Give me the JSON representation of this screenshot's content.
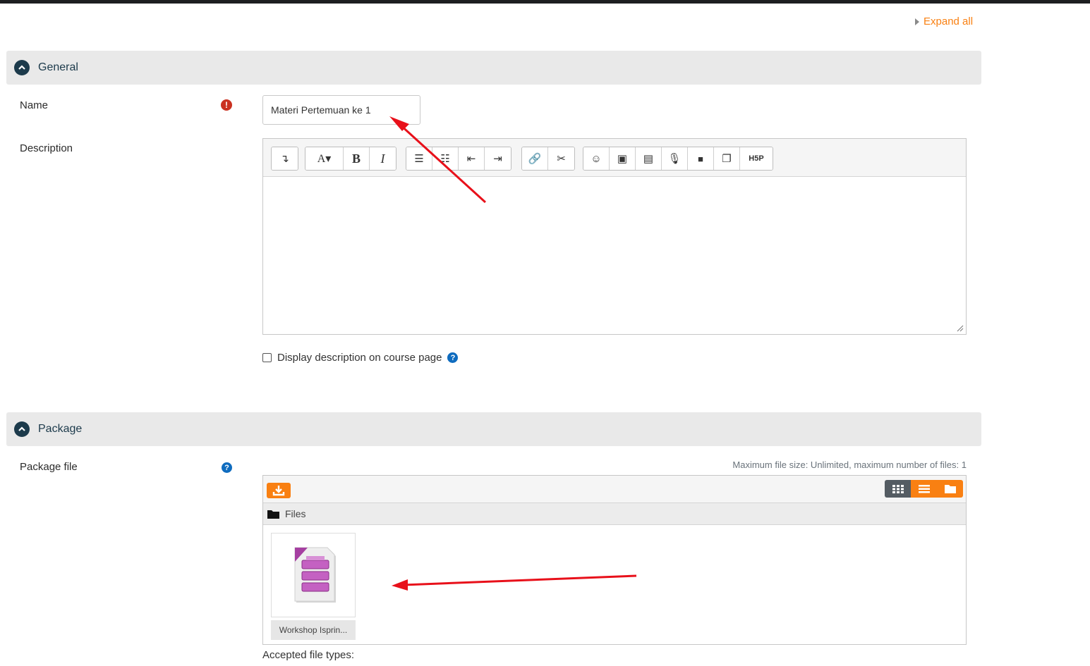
{
  "expand_all": "Expand all",
  "general": {
    "title": "General",
    "name_label": "Name",
    "name_value": "Materi Pertemuan ke 1",
    "required_icon": "exclamation-circle-icon",
    "description_label": "Description",
    "display_checkbox_label": "Display description on course page",
    "display_checkbox_checked": false
  },
  "editor_toolbar": {
    "groups": [
      [
        {
          "name": "collapse-icon",
          "glyph": "↴"
        }
      ],
      [
        {
          "name": "font-style-icon",
          "glyph": "A▾"
        },
        {
          "name": "bold-icon",
          "glyph": "B"
        },
        {
          "name": "italic-icon",
          "glyph": "I"
        }
      ],
      [
        {
          "name": "unordered-list-icon",
          "glyph": "☰"
        },
        {
          "name": "ordered-list-icon",
          "glyph": "☷"
        },
        {
          "name": "outdent-icon",
          "glyph": "⇤"
        },
        {
          "name": "indent-icon",
          "glyph": "⇥"
        }
      ],
      [
        {
          "name": "link-icon",
          "glyph": "🔗"
        },
        {
          "name": "unlink-icon",
          "glyph": "✂"
        }
      ],
      [
        {
          "name": "emoji-icon",
          "glyph": "☺"
        },
        {
          "name": "image-icon",
          "glyph": "▣"
        },
        {
          "name": "media-icon",
          "glyph": "▤"
        },
        {
          "name": "record-audio-icon",
          "glyph": "🎙"
        },
        {
          "name": "record-video-icon",
          "glyph": "■"
        },
        {
          "name": "manage-files-icon",
          "glyph": "❐"
        },
        {
          "name": "h5p-icon",
          "glyph": "H5P"
        }
      ]
    ]
  },
  "package": {
    "title": "Package",
    "package_file_label": "Package file",
    "max_size_text": "Maximum file size: Unlimited, maximum number of files: 1",
    "files_path": "Files",
    "file_name": "Workshop Isprin...",
    "accepted_types": "Accepted file types:"
  },
  "colors": {
    "accent": "#f98012",
    "section_header_bg": "#e9e9e9",
    "section_title": "#1c3a4b",
    "annotation_arrow": "#e8101a"
  }
}
